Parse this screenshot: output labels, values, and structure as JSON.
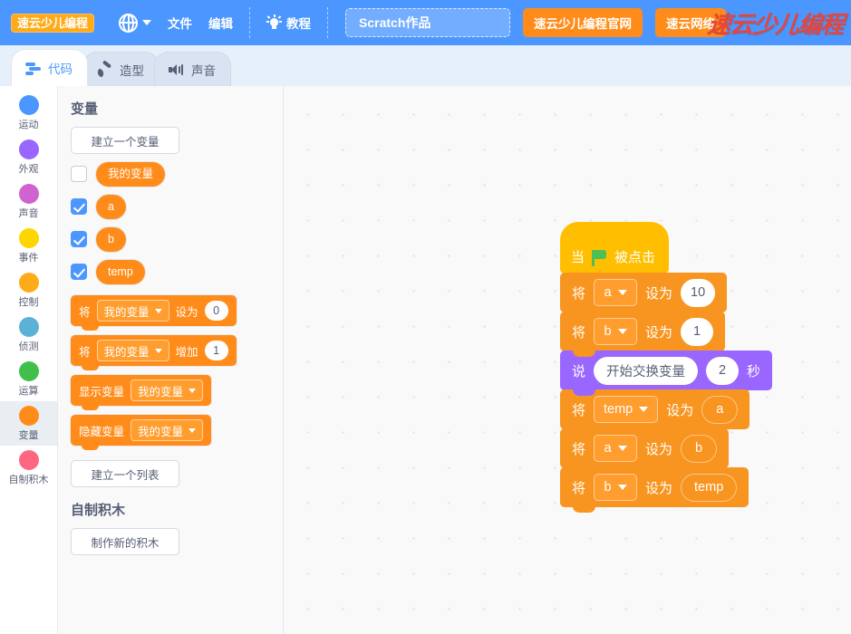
{
  "header": {
    "logo_text": "速云少儿编程",
    "language_icon": "globe-icon",
    "menus": [
      "文件",
      "编辑"
    ],
    "tutorial_label": "教程",
    "tutorial_icon": "lightbulb-icon",
    "project_name": "Scratch作品",
    "project_name_placeholder": "Scratch作品",
    "buttons": [
      "速云少儿编程官网",
      "速云网络"
    ],
    "brand_logo_text": "速云少儿编程",
    "colors": {
      "bar": "#4C97FF",
      "button": "#FF8C1A",
      "brand": "#E8443A"
    }
  },
  "tabs": [
    {
      "label": "代码",
      "icon": "code-icon",
      "active": true
    },
    {
      "label": "造型",
      "icon": "brush-icon",
      "active": false
    },
    {
      "label": "声音",
      "icon": "speaker-icon",
      "active": false
    }
  ],
  "categories": [
    {
      "label": "运动",
      "color": "#4C97FF",
      "selected": false
    },
    {
      "label": "外观",
      "color": "#9966FF",
      "selected": false
    },
    {
      "label": "声音",
      "color": "#CF63CF",
      "selected": false
    },
    {
      "label": "事件",
      "color": "#FFD500",
      "selected": false
    },
    {
      "label": "控制",
      "color": "#FFAB19",
      "selected": false
    },
    {
      "label": "侦测",
      "color": "#5CB1D6",
      "selected": false
    },
    {
      "label": "运算",
      "color": "#40BF4A",
      "selected": false
    },
    {
      "label": "变量",
      "color": "#FF8C1A",
      "selected": true
    },
    {
      "label": "自制积木",
      "color": "#FF6680",
      "selected": false
    }
  ],
  "palette": {
    "section_title": "变量",
    "make_variable_button": "建立一个变量",
    "variables": [
      {
        "name": "我的变量",
        "checked": false
      },
      {
        "name": "a",
        "checked": true
      },
      {
        "name": "b",
        "checked": true
      },
      {
        "name": "temp",
        "checked": true
      }
    ],
    "blocks": [
      {
        "pre": "将",
        "dropdown": "我的变量",
        "mid": "设为",
        "value": "0"
      },
      {
        "pre": "将",
        "dropdown": "我的变量",
        "mid": "增加",
        "value": "1"
      },
      {
        "pre": "显示变量",
        "dropdown": "我的变量"
      },
      {
        "pre": "隐藏变量",
        "dropdown": "我的变量"
      }
    ],
    "make_list_button": "建立一个列表",
    "custom_blocks_title": "自制积木",
    "make_block_button": "制作新的积木"
  },
  "script": {
    "hat": {
      "pre": "当",
      "icon": "green-flag-icon",
      "post": "被点击"
    },
    "blocks": [
      {
        "type": "set",
        "pre": "将",
        "dropdown": "a",
        "mid": "设为",
        "value": "10",
        "value_kind": "number"
      },
      {
        "type": "set",
        "pre": "将",
        "dropdown": "b",
        "mid": "设为",
        "value": "1",
        "value_kind": "number"
      },
      {
        "type": "say",
        "pre": "说",
        "text": "开始交换变量",
        "seconds": "2",
        "suffix": "秒"
      },
      {
        "type": "set",
        "pre": "将",
        "dropdown": "temp",
        "mid": "设为",
        "value": "a",
        "value_kind": "reporter"
      },
      {
        "type": "set",
        "pre": "将",
        "dropdown": "a",
        "mid": "设为",
        "value": "b",
        "value_kind": "reporter"
      },
      {
        "type": "set",
        "pre": "将",
        "dropdown": "b",
        "mid": "设为",
        "value": "temp",
        "value_kind": "reporter"
      }
    ]
  }
}
